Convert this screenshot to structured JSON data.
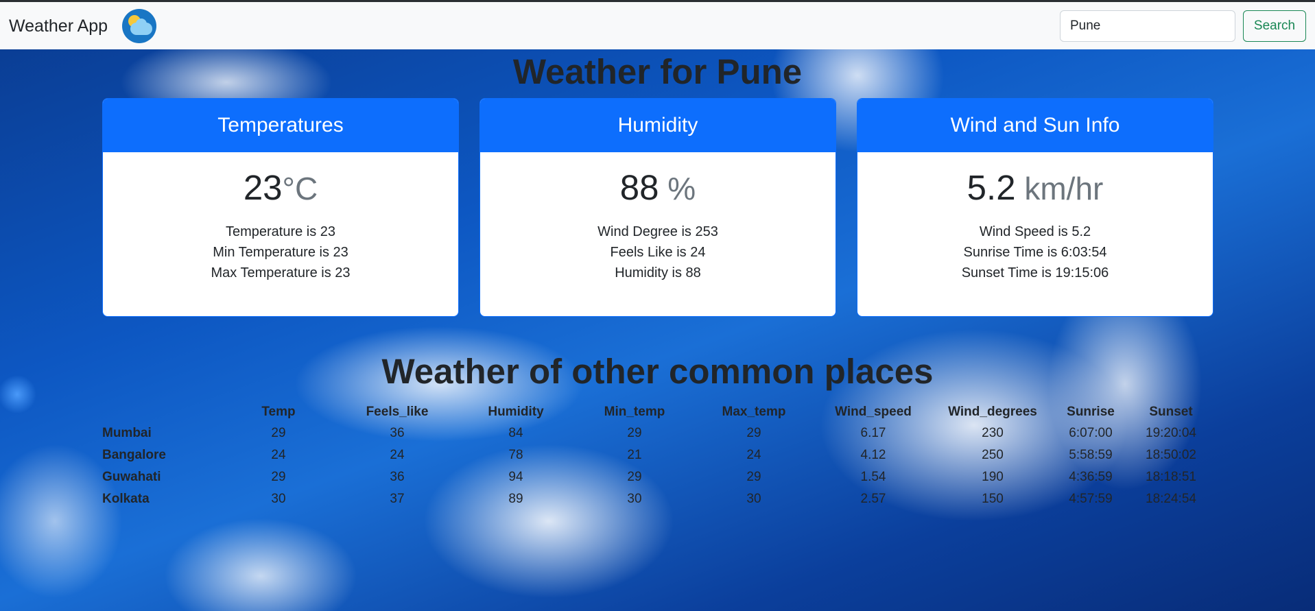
{
  "navbar": {
    "brand": "Weather App",
    "search_value": "Pune",
    "search_button": "Search"
  },
  "main_title": "Weather for Pune",
  "cards": [
    {
      "header": "Temperatures",
      "value": "23",
      "unit": "°C",
      "lines": [
        "Temperature is 23",
        "Min Temperature is 23",
        "Max Temperature is 23"
      ]
    },
    {
      "header": "Humidity",
      "value": "88",
      "unit": " %",
      "lines": [
        "Wind Degree is 253",
        "Feels Like is 24",
        "Humidity is 88"
      ]
    },
    {
      "header": "Wind and Sun Info",
      "value": "5.2",
      "unit": " km/hr",
      "lines": [
        "Wind Speed is 5.2",
        "Sunrise Time is 6:03:54",
        "Sunset Time is 19:15:06"
      ]
    }
  ],
  "other_title": "Weather of other common places",
  "table": {
    "columns": [
      "",
      "Temp",
      "Feels_like",
      "Humidity",
      "Min_temp",
      "Max_temp",
      "Wind_speed",
      "Wind_degrees",
      "Sunrise",
      "Sunset"
    ],
    "rows": [
      [
        "Mumbai",
        "29",
        "36",
        "84",
        "29",
        "29",
        "6.17",
        "230",
        "6:07:00",
        "19:20:04"
      ],
      [
        "Bangalore",
        "24",
        "24",
        "78",
        "21",
        "24",
        "4.12",
        "250",
        "5:58:59",
        "18:50:02"
      ],
      [
        "Guwahati",
        "29",
        "36",
        "94",
        "29",
        "29",
        "1.54",
        "190",
        "4:36:59",
        "18:18:51"
      ],
      [
        "Kolkata",
        "30",
        "37",
        "89",
        "30",
        "30",
        "2.57",
        "150",
        "4:57:59",
        "18:24:54"
      ]
    ]
  }
}
